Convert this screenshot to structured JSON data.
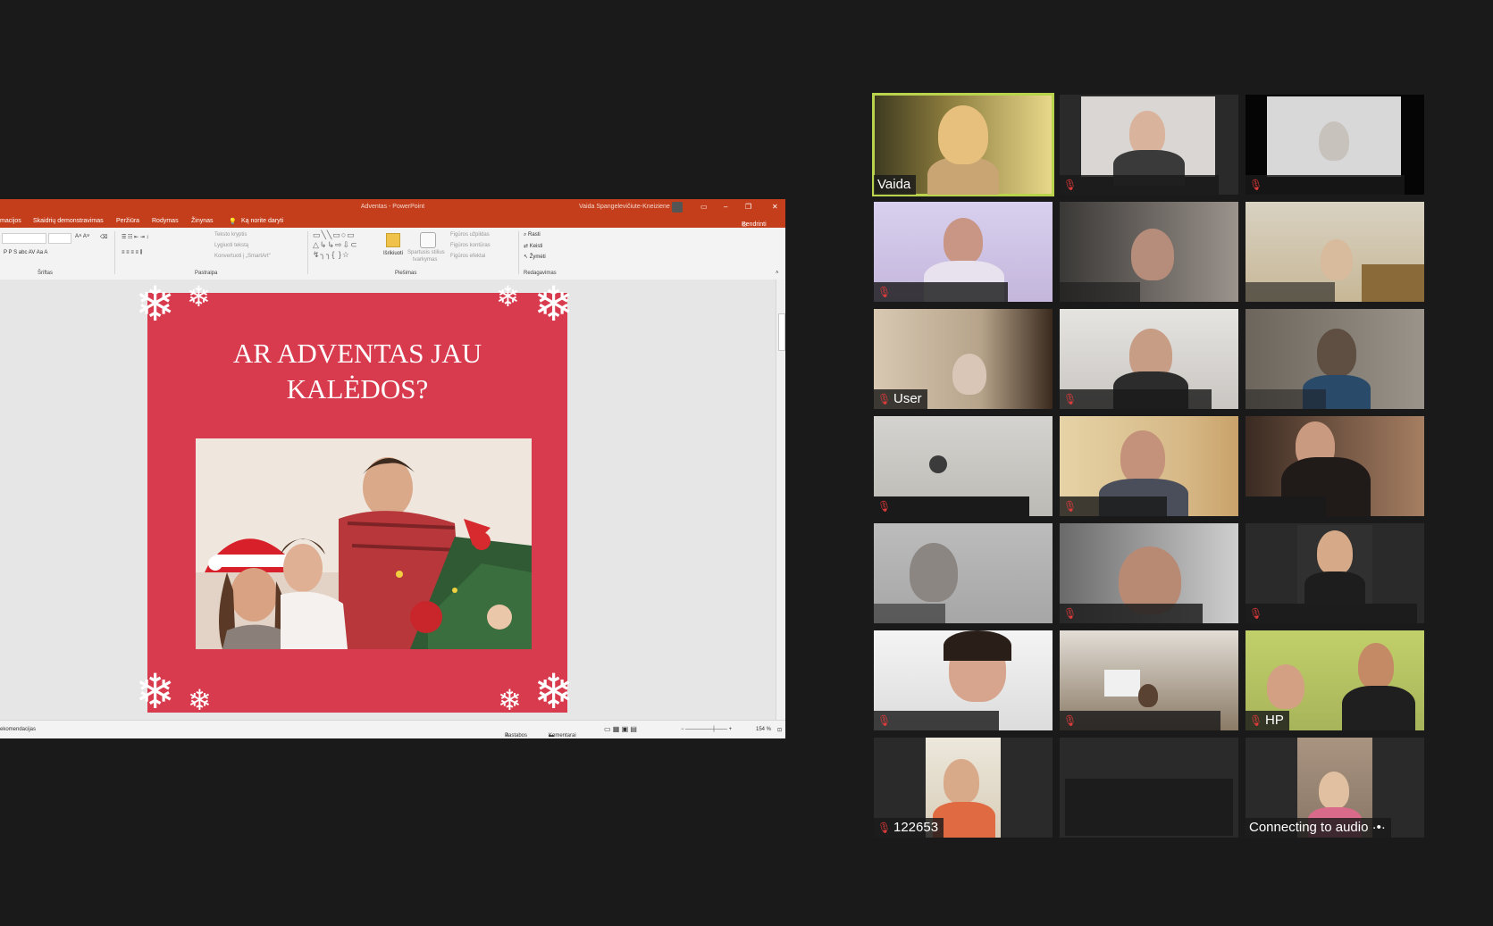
{
  "powerpoint": {
    "title": "Adventas - PowerPoint",
    "user_name": "Vaida Spangelevičiute-Kneiziene",
    "tabs": [
      "macijos",
      "Skaidrių demonstravimas",
      "Peržiūra",
      "Rodymas",
      "Žinynas",
      "Ką norite daryti"
    ],
    "share_label": "Bendrinti",
    "ribbon": {
      "groups": [
        "Šriftas",
        "Pastraipa",
        "Piešimas",
        "Redagavimas"
      ],
      "paragraph_items": [
        "Teksto kryptis",
        "Lygiuoti tekstą",
        "Konvertuoti į „SmartArt“"
      ],
      "arrange_label": "Išrikiuoti",
      "quick_styles_label": "Spartusis stilius",
      "quick_styles_sub": "tvarkymas",
      "shape_items": [
        "Figūros užpildas",
        "Figūros kontūras",
        "Figūros efektai"
      ],
      "editing_items": [
        "Rasti",
        "Keisti",
        "Žymėti"
      ]
    },
    "slide": {
      "headline_line1": "AR ADVENTAS JAU",
      "headline_line2": "KALĖDOS?"
    },
    "status": {
      "left": "ekomendacijas",
      "notes": "Pastabos",
      "comments": "Komentarai",
      "zoom": "154 %"
    }
  },
  "gallery": {
    "participants": [
      {
        "name": "Vaida",
        "muted": false,
        "active": true
      },
      {
        "name": "",
        "muted": true
      },
      {
        "name": "",
        "muted": true
      },
      {
        "name": "",
        "muted": true
      },
      {
        "name": "",
        "muted": false
      },
      {
        "name": "",
        "muted": false
      },
      {
        "name": "User",
        "muted": true
      },
      {
        "name": "",
        "muted": true
      },
      {
        "name": "",
        "muted": false
      },
      {
        "name": "",
        "muted": true
      },
      {
        "name": "",
        "muted": true
      },
      {
        "name": "",
        "muted": false
      },
      {
        "name": "",
        "muted": false
      },
      {
        "name": "",
        "muted": true
      },
      {
        "name": "",
        "muted": true
      },
      {
        "name": "",
        "muted": true
      },
      {
        "name": "",
        "muted": true
      },
      {
        "name": "HP",
        "muted": true
      },
      {
        "name": "122653",
        "muted": true
      },
      {
        "name": "",
        "muted": false
      },
      {
        "name": "Connecting to audio",
        "muted": false
      }
    ]
  }
}
